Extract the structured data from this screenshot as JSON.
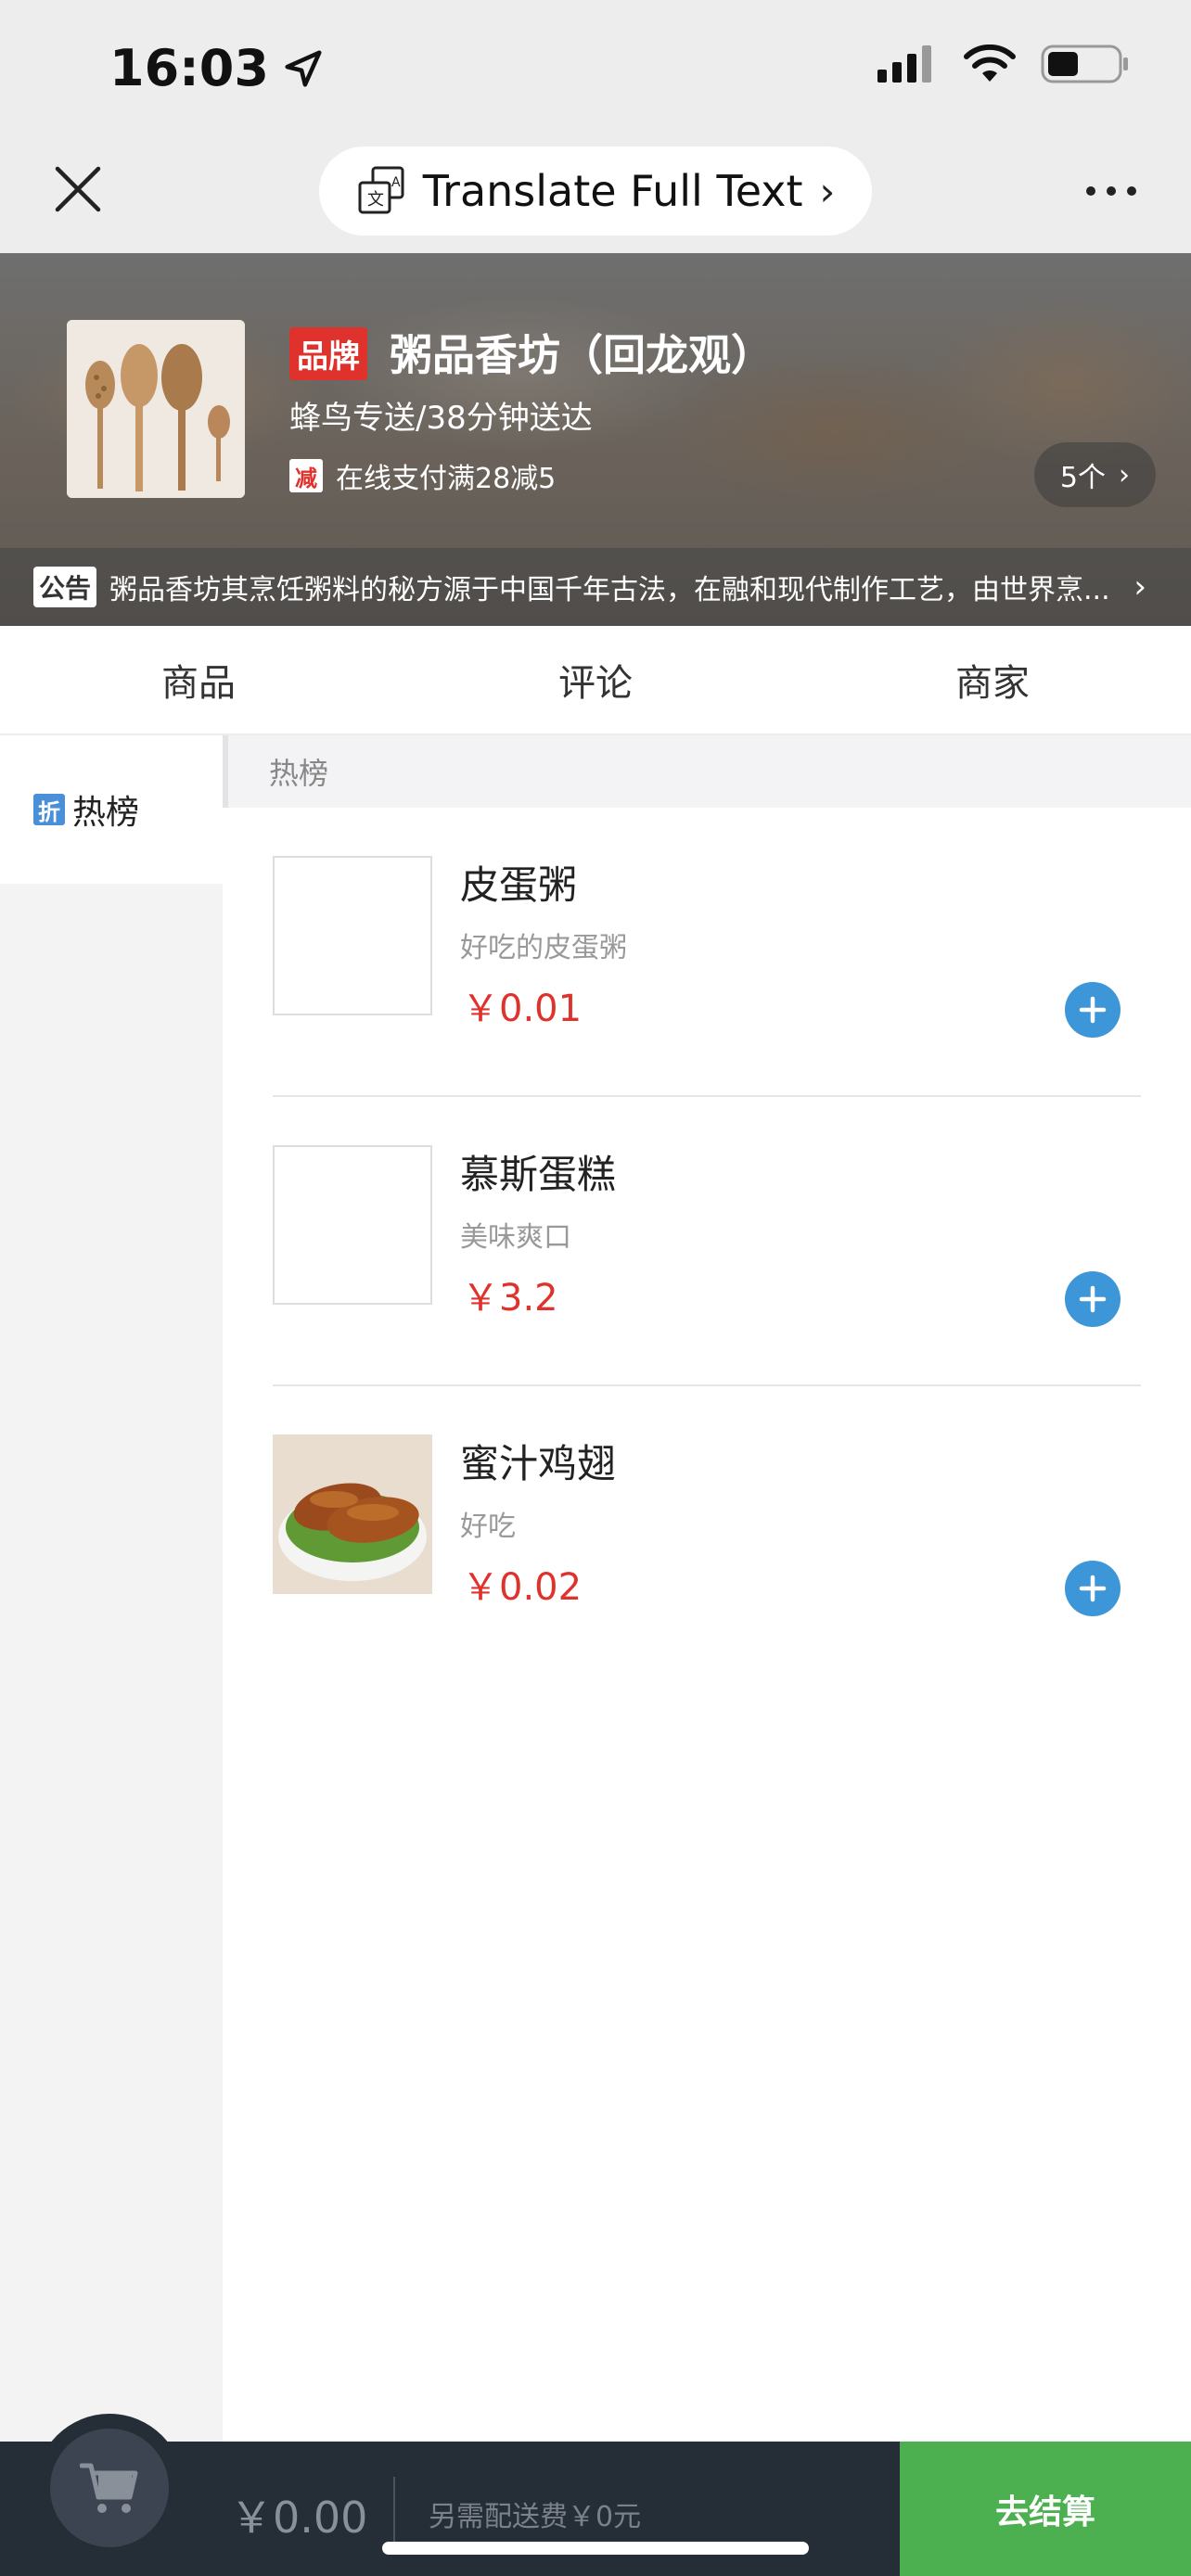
{
  "status_bar": {
    "time": "16:03"
  },
  "nav": {
    "translate_label": "Translate Full Text"
  },
  "shop": {
    "brand_badge": "品牌",
    "name": "粥品香坊（回龙观）",
    "delivery": "蜂鸟专送/38分钟送达",
    "promo_tag": "减",
    "promo_text": "在线支付满28减5",
    "promo_count": "5个",
    "notice_tag": "公告",
    "notice_text": "粥品香坊其烹饪粥料的秘方源于中国千年古法，在融和现代制作工艺，由世界烹..."
  },
  "tabs": [
    {
      "label": "商品"
    },
    {
      "label": "评论"
    },
    {
      "label": "商家"
    }
  ],
  "sidebar": {
    "items": [
      {
        "tag": "折",
        "label": "热榜"
      }
    ]
  },
  "section": {
    "title": "热榜"
  },
  "products": [
    {
      "name": "皮蛋粥",
      "desc": "好吃的皮蛋粥",
      "price": "￥0.01"
    },
    {
      "name": "慕斯蛋糕",
      "desc": "美味爽口",
      "price": "￥3.2"
    },
    {
      "name": "蜜汁鸡翅",
      "desc": "好吃",
      "price": "￥0.02"
    }
  ],
  "cart": {
    "total": "￥0.00",
    "delivery_fee": "另需配送费￥0元",
    "checkout_label": "去结算"
  },
  "colors": {
    "price_red": "#e0322c",
    "add_blue": "#3c96d8",
    "checkout_green": "#4caf50",
    "cart_bg": "#252d37"
  }
}
